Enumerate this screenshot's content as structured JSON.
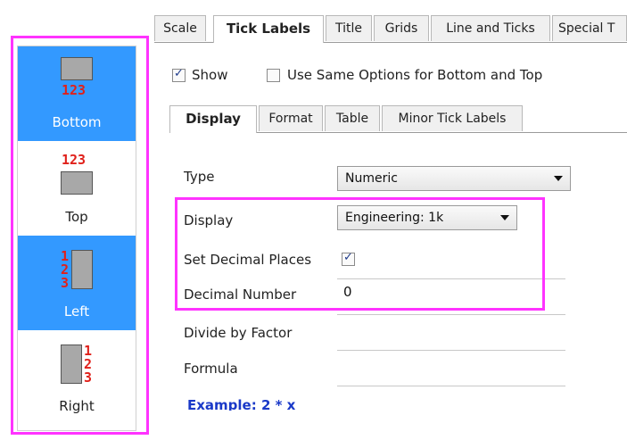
{
  "sidebar": {
    "items": [
      {
        "label": "Bottom",
        "icon": "bottom-ticks-icon",
        "digits": "123",
        "selected": true
      },
      {
        "label": "Top",
        "icon": "top-ticks-icon",
        "digits": "123",
        "selected": false
      },
      {
        "label": "Left",
        "icon": "left-ticks-icon",
        "digits": [
          "1",
          "2",
          "3"
        ],
        "selected": true
      },
      {
        "label": "Right",
        "icon": "right-ticks-icon",
        "digits": [
          "1",
          "2",
          "3"
        ],
        "selected": false
      }
    ]
  },
  "tabs": [
    "Scale",
    "Tick Labels",
    "Title",
    "Grids",
    "Line and Ticks",
    "Special T"
  ],
  "active_tab": "Tick Labels",
  "options": {
    "show_label": "Show",
    "show_checked": true,
    "same_options_label": "Use Same Options for Bottom and Top",
    "same_options_checked": false
  },
  "subtabs": [
    "Display",
    "Format",
    "Table",
    "Minor Tick Labels"
  ],
  "active_subtab": "Display",
  "form": {
    "type_label": "Type",
    "type_value": "Numeric",
    "display_label": "Display",
    "display_value": "Engineering: 1k",
    "set_decimal_label": "Set Decimal Places",
    "set_decimal_checked": true,
    "decimal_number_label": "Decimal Number",
    "decimal_number_value": "0",
    "divide_label": "Divide by Factor",
    "divide_value": "",
    "formula_label": "Formula",
    "formula_value": "",
    "example_text": "Example: 2 * x"
  },
  "colors": {
    "highlight": "#ff33ff",
    "selection": "#3399ff",
    "tick_digits": "#e0201a",
    "example_text": "#1a39c8"
  }
}
